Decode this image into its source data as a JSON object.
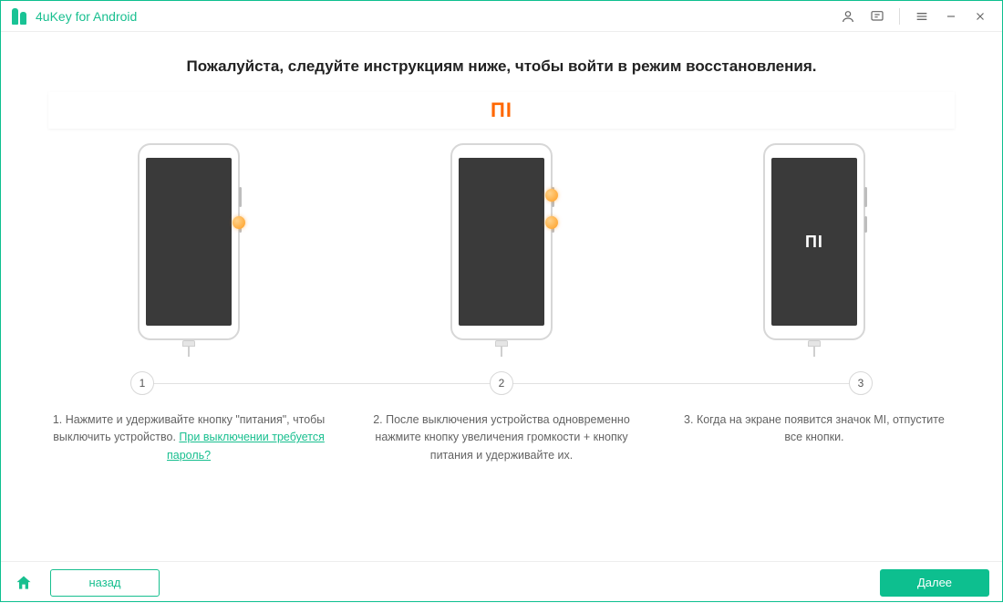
{
  "app": {
    "title": "4uKey for Android"
  },
  "colors": {
    "accent": "#18bf8f",
    "brand": "#ff6700"
  },
  "icons": {
    "account": "account-icon",
    "feedback": "feedback-icon",
    "menu": "menu-icon",
    "minimize": "minimize-icon",
    "close": "close-icon",
    "home": "home-icon"
  },
  "headline": "Пожалуйста, следуйте инструкциям ниже, чтобы войти в режим восстановления.",
  "brand": {
    "logo_text": "MI"
  },
  "steps": {
    "numbers": [
      "1",
      "2",
      "3"
    ],
    "captions": {
      "s1": {
        "text": "1. Нажмите и удерживайте кнопку \"питания\", чтобы выключить устройство. ",
        "link": "При выключении требуется пароль?"
      },
      "s2": {
        "text": "2. После выключения устройства одновременно нажмите кнопку увеличения громкости + кнопку питания и удерживайте их."
      },
      "s3": {
        "text": "3. Когда на экране появится значок MI, отпустите все кнопки."
      }
    },
    "screen_logo": "ПI"
  },
  "footer": {
    "back_label": "назад",
    "next_label": "Далее"
  }
}
